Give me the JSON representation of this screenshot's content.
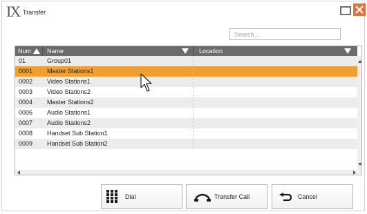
{
  "window": {
    "title": "Transfer",
    "app_icon_text": "IX"
  },
  "search": {
    "placeholder": "Search...",
    "value": ""
  },
  "table": {
    "columns": [
      {
        "label": "Num"
      },
      {
        "label": "Name"
      },
      {
        "label": "Location"
      }
    ],
    "rows": [
      {
        "num": "01",
        "name": "Group01",
        "location": "",
        "selected": false
      },
      {
        "num": "0001",
        "name": "Master Stations1",
        "location": "",
        "selected": true
      },
      {
        "num": "0002",
        "name": "Video Stations1",
        "location": "",
        "selected": false
      },
      {
        "num": "0003",
        "name": "Video Stations2",
        "location": "",
        "selected": false
      },
      {
        "num": "0004",
        "name": "Master Stations2",
        "location": "",
        "selected": false
      },
      {
        "num": "0006",
        "name": "Audio Stations1",
        "location": "",
        "selected": false
      },
      {
        "num": "0007",
        "name": "Audio Stations2",
        "location": "",
        "selected": false
      },
      {
        "num": "0008",
        "name": "Handset Sub Station1",
        "location": "",
        "selected": false
      },
      {
        "num": "0009",
        "name": "Handset Sub Station2",
        "location": "",
        "selected": false
      }
    ]
  },
  "buttons": {
    "dial": {
      "label": "Dial",
      "icon": "keypad-icon"
    },
    "transfer_call": {
      "label": "Transfer Call",
      "icon": "handset-icon"
    },
    "cancel": {
      "label": "Cancel",
      "icon": "return-arrow-icon"
    }
  },
  "colors": {
    "selected_row": "#f0a030",
    "header_bg": "#6b6b6b",
    "close_button": "#e2743a"
  }
}
